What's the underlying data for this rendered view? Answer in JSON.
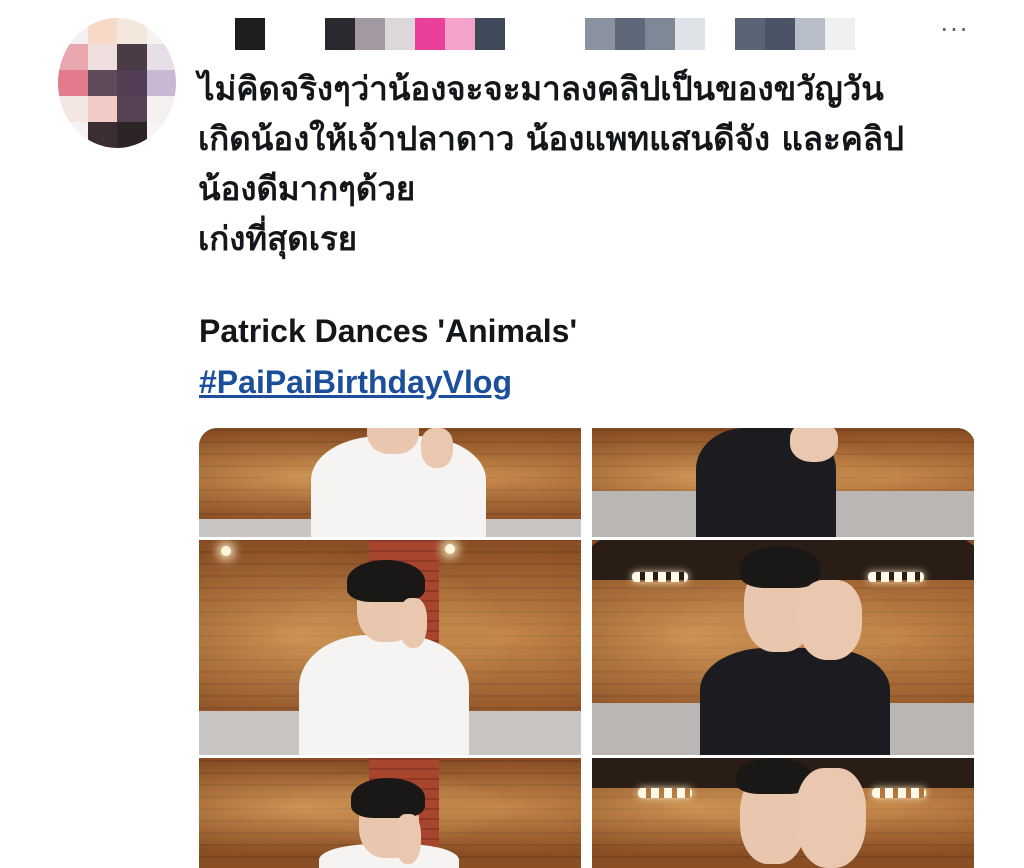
{
  "tweet": {
    "more_label": "···",
    "text_lines": [
      "ไม่คิดจริงๆว่าน้องจะจะมาลงคลิปเป็นของขวัญวัน",
      "เกิดน้องให้เจ้าปลาดาว น้องแพทแสนดีจัง และคลิป",
      "น้องดีมากๆด้วย",
      "เก่งที่สุดเรย"
    ],
    "video_title": "Patrick Dances 'Animals'",
    "hashtag": "#PaiPaiBirthdayVlog"
  },
  "colors": {
    "text": "#14171a",
    "hashtag": "#1b4f9c",
    "muted": "#536471"
  },
  "icons": {
    "more": "ellipsis-horizontal-icon"
  }
}
